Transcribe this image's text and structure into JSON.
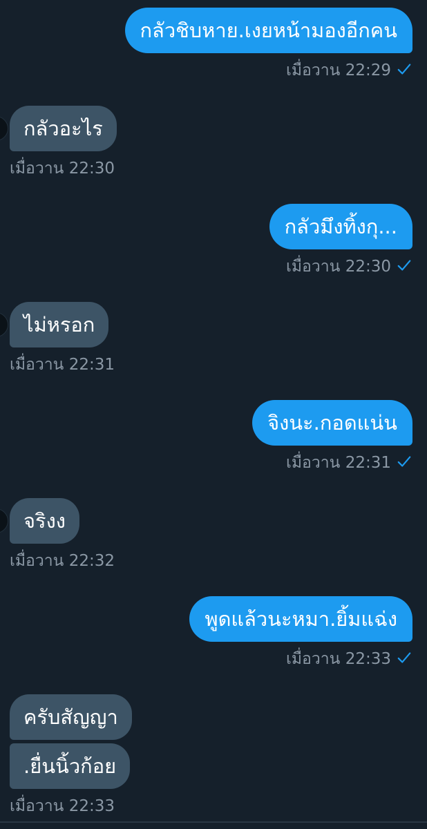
{
  "messages": [
    {
      "text": "กลัวชิบหาย.เงยหน้ามองอีกคน",
      "time": "เมื่อวาน 22:29"
    },
    {
      "text": "กลัวอะไร",
      "time": "เมื่อวาน 22:30"
    },
    {
      "text": "กลัวมึงทิ้งกุ...",
      "time": "เมื่อวาน 22:30"
    },
    {
      "text": "ไม่หรอก",
      "time": "เมื่อวาน 22:31"
    },
    {
      "text": "จิงนะ.กอดแน่น",
      "time": "เมื่อวาน 22:31"
    },
    {
      "text": "จริงง",
      "time": "เมื่อวาน 22:32"
    },
    {
      "text": "พูดแล้วนะหมา.ยิ้มแฉ่ง",
      "time": "เมื่อวาน 22:33"
    },
    {
      "text": "ครับสัญญา"
    },
    {
      "text": ".ยื่นนิ้วก้อย",
      "time": "เมื่อวาน 22:33"
    }
  ],
  "colors": {
    "background": "#15202b",
    "outgoing_bubble": "#1d9bf0",
    "incoming_bubble": "#3d5466",
    "timestamp": "#8b98a5",
    "read_check": "#1d9bf0"
  },
  "icons": {
    "read_receipt": "check-icon"
  }
}
